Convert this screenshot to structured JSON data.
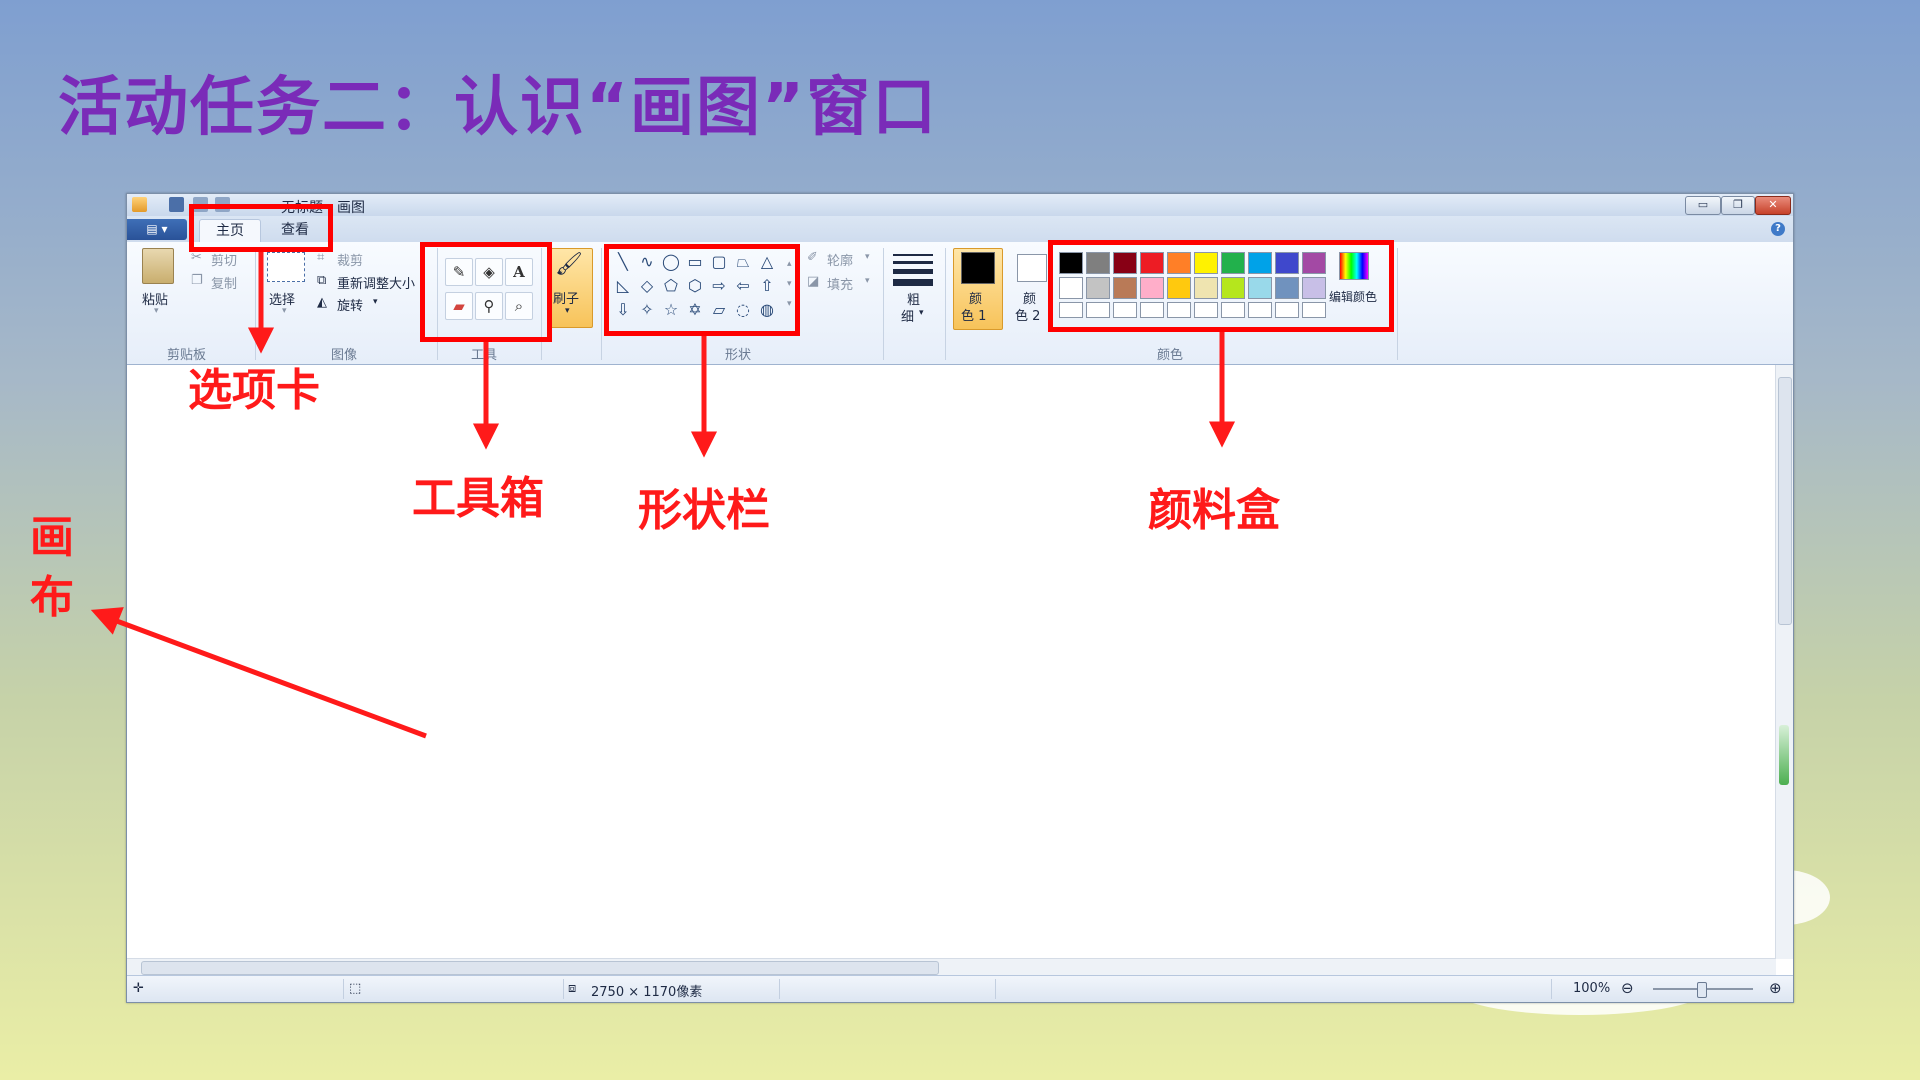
{
  "slide": {
    "title": "活动任务二：认识“画图”窗口"
  },
  "window": {
    "title": "无标题 - 画图",
    "file_menu_glyph": "▤ ▾",
    "help_glyph": "?",
    "controls": {
      "minimize": "▭",
      "restore": "❐",
      "close": "✕"
    }
  },
  "tabs": {
    "home": "主页",
    "view": "查看"
  },
  "ribbon": {
    "clipboard": {
      "paste": "粘贴",
      "cut": "剪切",
      "copy": "复制",
      "group": "剪贴板"
    },
    "image": {
      "select": "选择",
      "crop": "裁剪",
      "resize": "重新调整大小",
      "rotate": "旋转",
      "group": "图像"
    },
    "tools": {
      "group": "工具"
    },
    "brushes": {
      "label": "刷子"
    },
    "shapes": {
      "group": "形状",
      "outline": "轮廓",
      "fill": "填充"
    },
    "size": {
      "line1": "粗",
      "line2": "细"
    },
    "color1": {
      "line1": "颜",
      "line2": "色 1"
    },
    "color2": {
      "line1": "颜",
      "line2": "色 2"
    },
    "colors": {
      "group": "颜色",
      "edit": "编辑颜色"
    }
  },
  "palette_row1": [
    "#000000",
    "#7f7f7f",
    "#880015",
    "#ed1c24",
    "#ff7f27",
    "#fff200",
    "#22b14c",
    "#00a2e8",
    "#3f48cc",
    "#a349a4"
  ],
  "palette_row2": [
    "#ffffff",
    "#c3c3c3",
    "#b97a57",
    "#ffaec9",
    "#ffc90e",
    "#efe4b0",
    "#b5e61d",
    "#99d9ea",
    "#7092be",
    "#c8bfe7"
  ],
  "status": {
    "dimensions": "2750 × 1170像素",
    "zoom": "100%"
  },
  "annotations": {
    "tabs": "选项卡",
    "toolbox": "工具箱",
    "shapes_bar": "形状栏",
    "palette": "颜料盒",
    "canvas": "画布"
  },
  "colors": {
    "annotation_red": "#ff0000",
    "title_purple": "#7a2bb8"
  }
}
